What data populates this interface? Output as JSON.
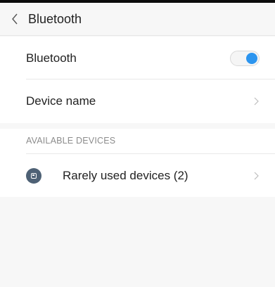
{
  "header": {
    "title": "Bluetooth",
    "back_icon": "chevron-left-icon"
  },
  "settings": {
    "bluetooth": {
      "label": "Bluetooth",
      "enabled": true,
      "toggle_color": "#2c95ef"
    },
    "device_name": {
      "label": "Device name",
      "icon": "chevron-right-icon"
    }
  },
  "available_devices": {
    "section_label": "AVAILABLE DEVICES",
    "items": [
      {
        "label": "Rarely used devices (2)",
        "icon": "device-group-icon",
        "icon_color": "#4e6175",
        "chevron": "chevron-right-icon"
      }
    ]
  }
}
